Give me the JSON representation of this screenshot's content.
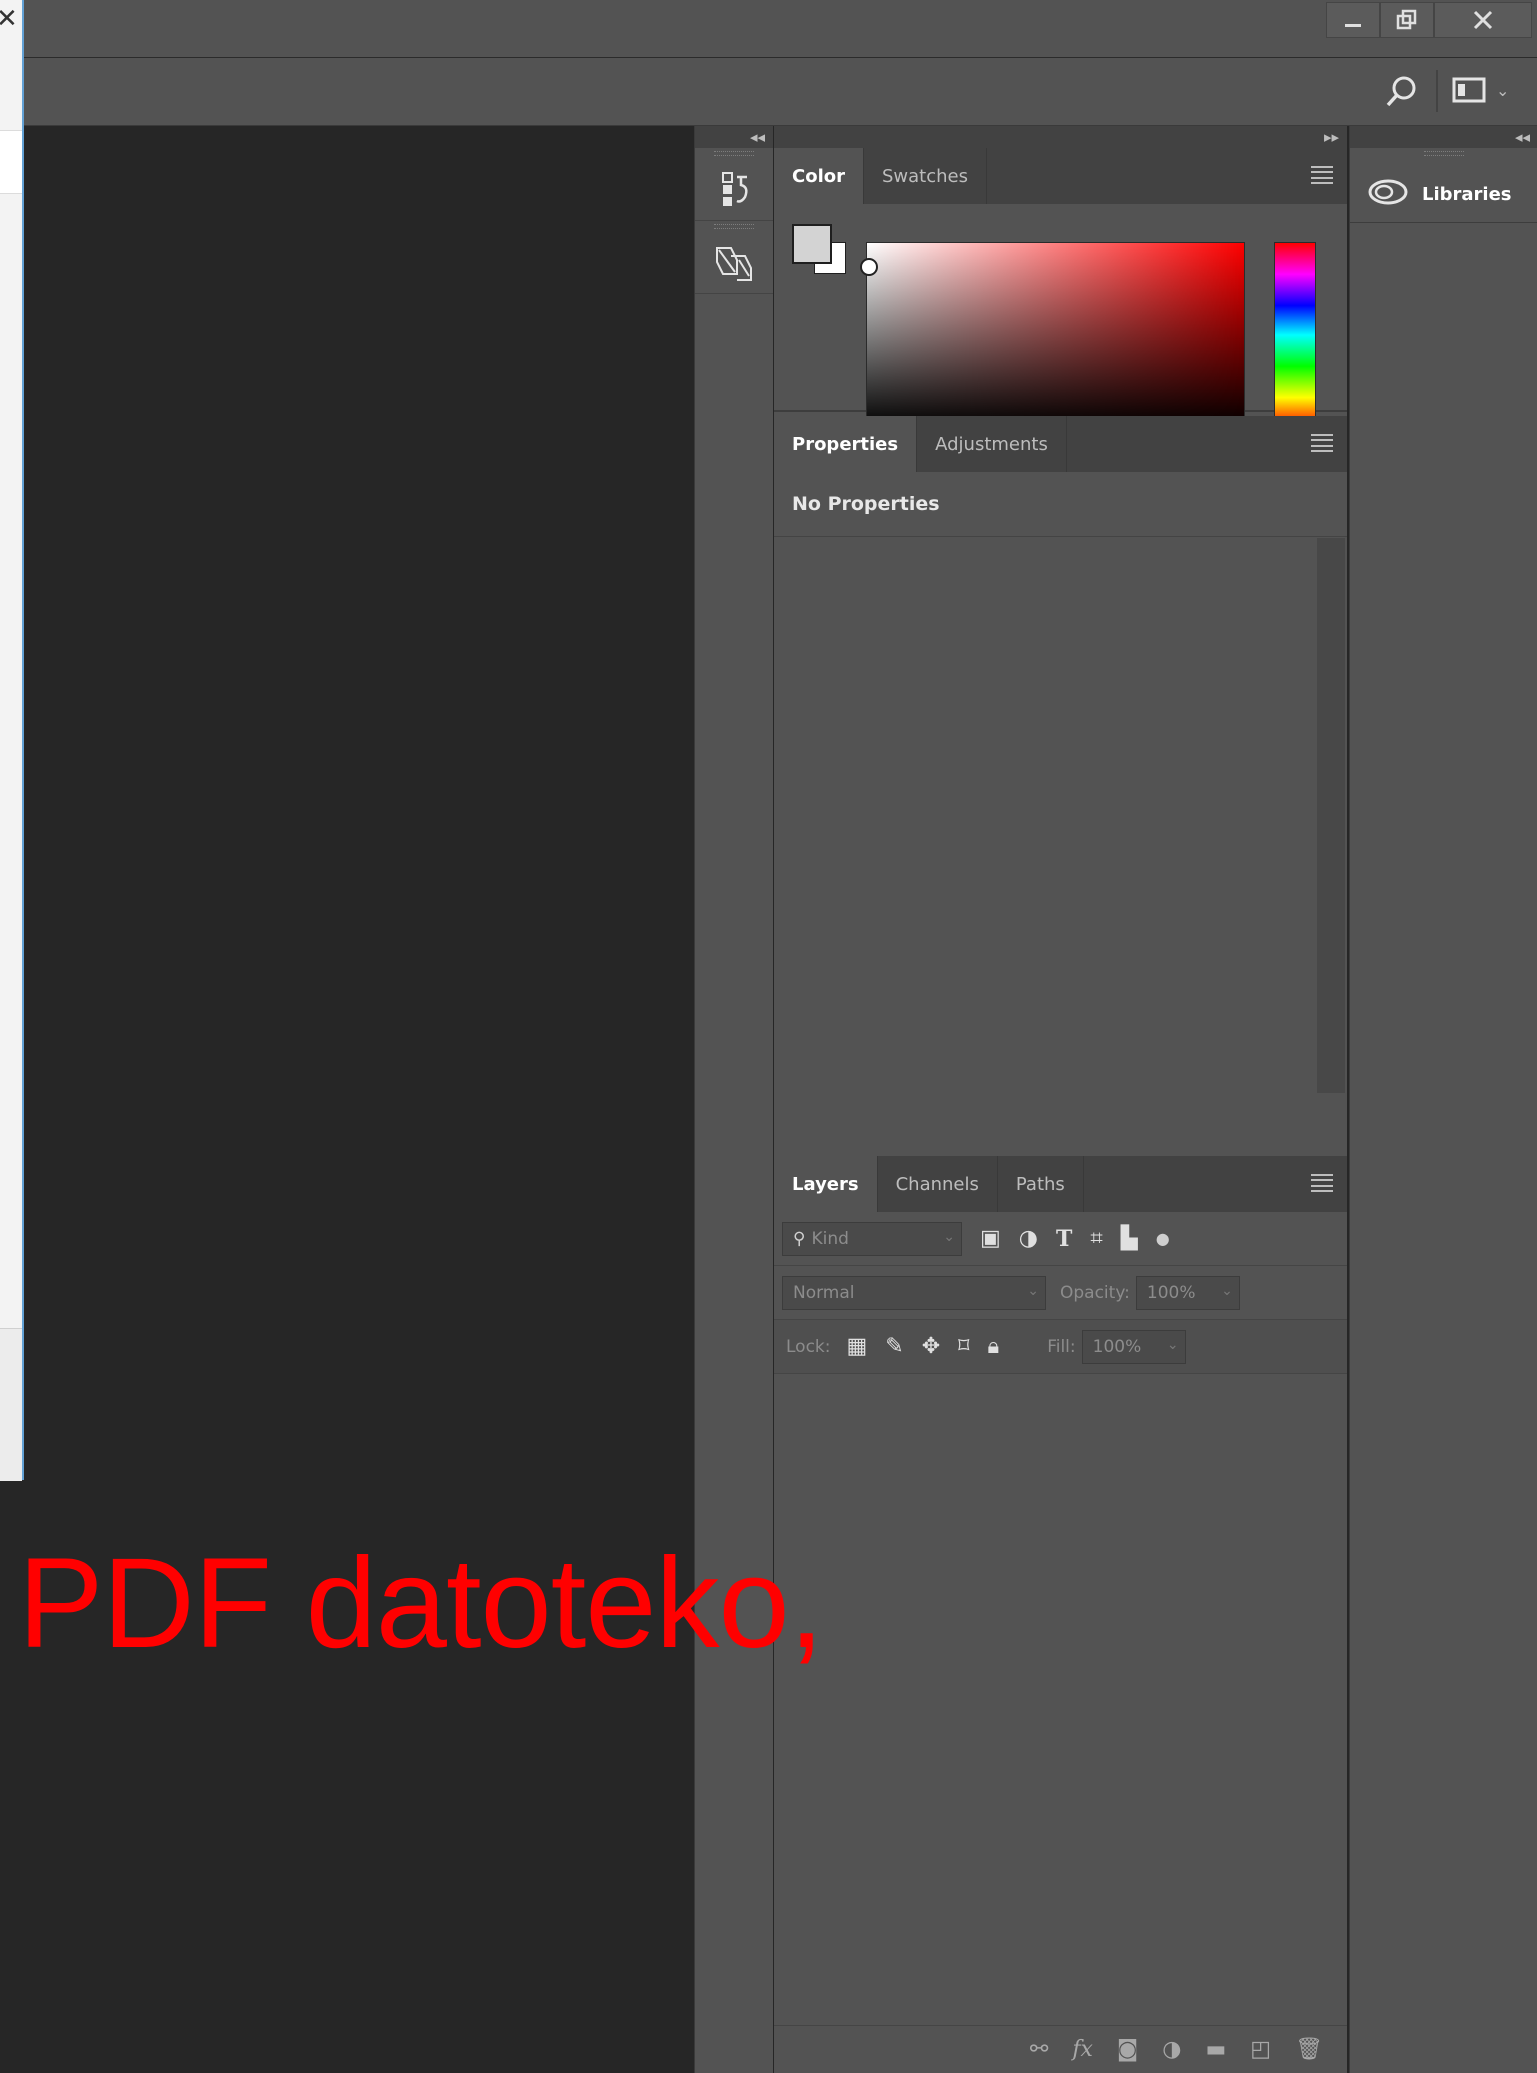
{
  "window": {
    "minimize_icon": "minimize-icon",
    "restore_icon": "restore-icon",
    "close_icon": "close-icon"
  },
  "optionsbar": {
    "search_icon": "search-icon",
    "workspace_icon": "workspace-icon"
  },
  "canvas": {
    "overlay_text": "PDF datoteko,",
    "overlay_color": "#ff0000"
  },
  "dock": {
    "collapse_left": "◂◂",
    "expand_right": "▸▸",
    "collapse_right": "◂◂",
    "icons": [
      "history-icon",
      "properties-toggle-icon"
    ]
  },
  "color_panel": {
    "tabs": [
      "Color",
      "Swatches"
    ],
    "active_tab": "Color",
    "foreground": "#d3d3d3",
    "background": "#ffffff"
  },
  "properties_panel": {
    "tabs": [
      "Properties",
      "Adjustments"
    ],
    "active_tab": "Properties",
    "message": "No Properties"
  },
  "layers_panel": {
    "tabs": [
      "Layers",
      "Channels",
      "Paths"
    ],
    "active_tab": "Layers",
    "filter_label": "Kind",
    "blend_mode": "Normal",
    "opacity_label": "Opacity:",
    "opacity_value": "100%",
    "lock_label": "Lock:",
    "fill_label": "Fill:",
    "fill_value": "100%"
  },
  "libraries": {
    "label": "Libraries"
  }
}
